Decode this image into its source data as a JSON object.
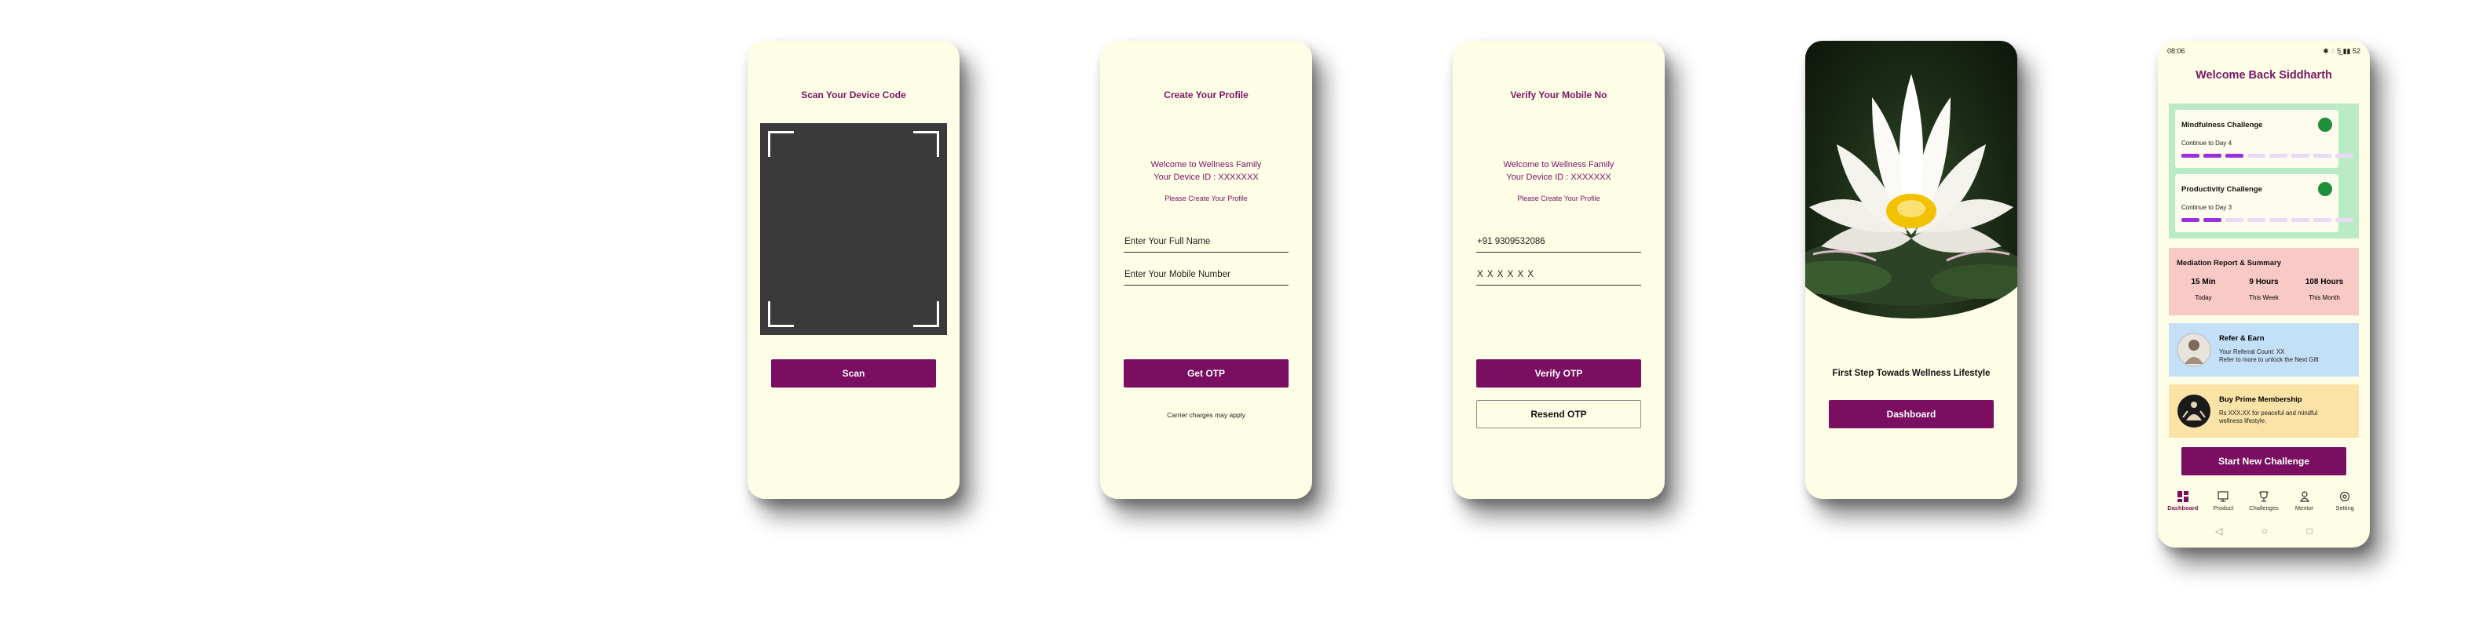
{
  "screens": {
    "scan": {
      "title": "Scan Your Device Code",
      "button": "Scan"
    },
    "profile": {
      "title": "Create Your Profile",
      "welcome_line1": "Welcome to Wellness Family",
      "welcome_line2": "Your Device ID : XXXXXXX",
      "prompt": "Please Create Your Profile",
      "name_placeholder": "Enter Your Full Name",
      "mobile_placeholder": "Enter Your Mobile Number",
      "button": "Get OTP",
      "note": "Carrier charges may apply"
    },
    "verify": {
      "title": "Verify Your Mobile No",
      "welcome_line1": "Welcome to Wellness Family",
      "welcome_line2": "Your Device ID : XXXXXXX",
      "prompt": "Please Create Your Profile",
      "phone_value": "+91 9309532086",
      "otp_value": "X X X X X X",
      "verify_button": "Verify OTP",
      "resend_button": "Resend OTP"
    },
    "splash": {
      "tagline": "First Step Towads Wellness Lifestyle",
      "button": "Dashboard"
    },
    "dashboard": {
      "status_time": "08:06",
      "status_icons": "✱ ◌ 5̲ ▮▮ 52",
      "welcome": "Welcome Back Siddharth",
      "challenges": [
        {
          "title": "Mindfulness Challenge",
          "subtitle": "Continue to Day 4",
          "progress": 3,
          "total": 8
        },
        {
          "title": "Productivity Challenge",
          "subtitle": "Continue to Day 3",
          "progress": 2,
          "total": 8
        }
      ],
      "report": {
        "title": "Mediation Report & Summary",
        "stats": [
          {
            "value": "15 Min",
            "label": "Today"
          },
          {
            "value": "9 Hours",
            "label": "This Week"
          },
          {
            "value": "108 Hours",
            "label": "This Month"
          }
        ]
      },
      "refer": {
        "title": "Refer & Earn",
        "line1": "Your Referral Count: XX",
        "line2": "Refer to more to unlock the Next Gift"
      },
      "prime": {
        "title": "Buy Prime Membership",
        "line1": "Rs XXX.XX for peaceful and mindful",
        "line2": "wellness lifestyle."
      },
      "start_button": "Start New Challenge",
      "nav": [
        {
          "label": "Dashboard",
          "icon": "dashboard-icon"
        },
        {
          "label": "Product",
          "icon": "monitor-icon"
        },
        {
          "label": "Challenges",
          "icon": "trophy-icon"
        },
        {
          "label": "Mentor",
          "icon": "mentor-icon"
        },
        {
          "label": "Setting",
          "icon": "settings-icon"
        }
      ]
    }
  },
  "colors": {
    "brand_purple": "#7a0e60",
    "screen_bg": "#fefde6",
    "challenge_green": "#b9ecc4",
    "report_pink": "#f9c9c6",
    "refer_blue": "#c4e0f8",
    "prime_yellow": "#fbe3a8"
  }
}
